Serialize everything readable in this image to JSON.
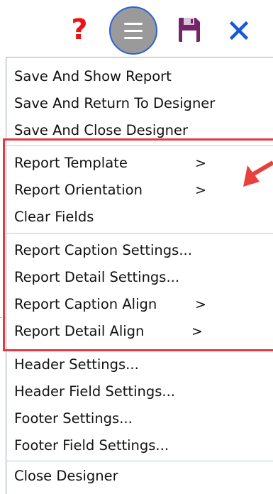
{
  "toolbar": {
    "help_glyph": "?",
    "icons": [
      "help-icon",
      "hamburger-menu-icon",
      "save-disk-icon",
      "close-x-icon"
    ],
    "colors": {
      "help": "#ee1111",
      "menu_button_fill": "#9a9a9a",
      "menu_button_border": "#2a63d6",
      "save_icon": "#75246a",
      "close_icon": "#1559d6"
    }
  },
  "menu": {
    "groups": [
      {
        "items": [
          {
            "label": "Save And Show Report"
          },
          {
            "label": "Save And Return To Designer"
          },
          {
            "label": "Save And Close Designer"
          }
        ]
      },
      {
        "items": [
          {
            "label": "Report Template",
            "submenu": ">"
          },
          {
            "label": "Report Orientation",
            "submenu": ">"
          },
          {
            "label": "Clear Fields"
          }
        ]
      },
      {
        "items": [
          {
            "label": "Report Caption Settings..."
          },
          {
            "label": "Report Detail Settings..."
          },
          {
            "label": "Report Caption Align",
            "submenu": ">"
          },
          {
            "label": "Report Detail Align",
            "submenu": ">"
          }
        ]
      },
      {
        "items": [
          {
            "label": "Header Settings..."
          },
          {
            "label": "Header Field Settings..."
          },
          {
            "label": "Footer Settings..."
          },
          {
            "label": "Footer Field Settings..."
          }
        ]
      },
      {
        "items": [
          {
            "label": "Close Designer"
          }
        ]
      }
    ]
  },
  "annotation": {
    "highlight_color": "#e23a44",
    "pointer": "red-arrow-icon"
  }
}
